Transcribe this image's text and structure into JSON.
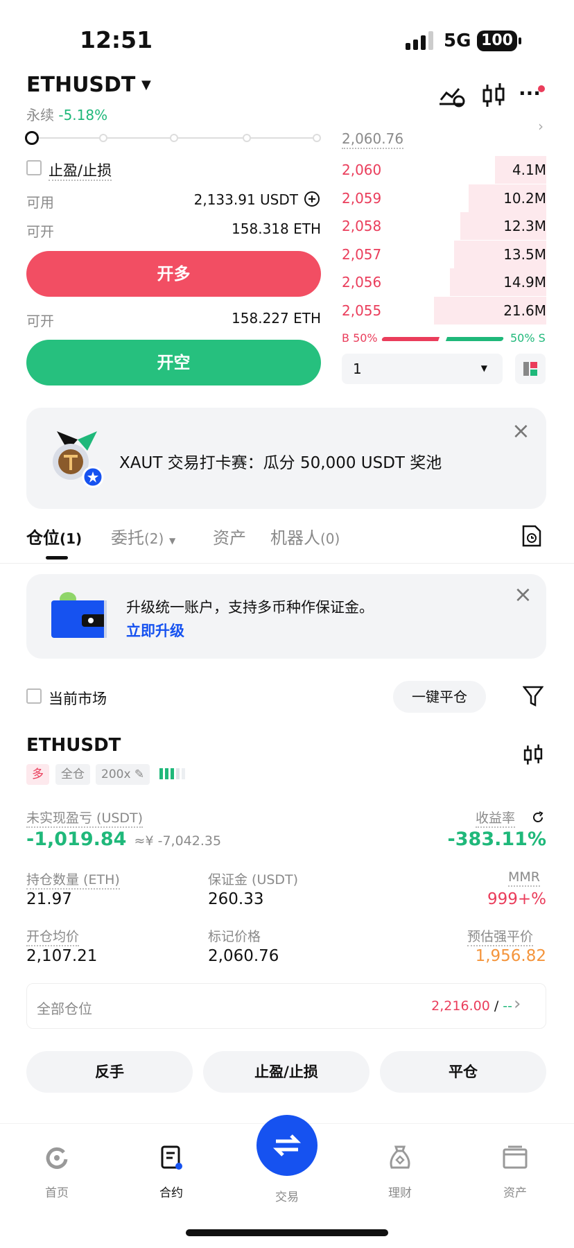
{
  "status": {
    "time": "12:51",
    "network": "5G",
    "battery": "100"
  },
  "header": {
    "symbol": "ETHUSDT",
    "contract_type": "永续",
    "change": "-5.18%"
  },
  "order_form": {
    "tp_sl_label": "止盈/止损",
    "available_label": "可用",
    "available_value": "2,133.91 USDT",
    "long_open_label": "可开",
    "long_open_value": "158.318 ETH",
    "long_button": "开多",
    "short_open_label": "可开",
    "short_open_value": "158.227 ETH",
    "short_button": "开空"
  },
  "order_book": {
    "last_price": "2,060.76",
    "asks": [
      {
        "price": "2,060",
        "qty": "4.1M",
        "depth": 0.25
      },
      {
        "price": "2,059",
        "qty": "10.2M",
        "depth": 0.38
      },
      {
        "price": "2,058",
        "qty": "12.3M",
        "depth": 0.42
      },
      {
        "price": "2,057",
        "qty": "13.5M",
        "depth": 0.45
      },
      {
        "price": "2,056",
        "qty": "14.9M",
        "depth": 0.47
      },
      {
        "price": "2,055",
        "qty": "21.6M",
        "depth": 0.55
      }
    ],
    "buy_ratio": "B 50%",
    "sell_ratio": "50% S",
    "buy_fraction": 0.5,
    "precision_value": "1"
  },
  "promo": {
    "text": "XAUT 交易打卡赛：瓜分 50,000 USDT 奖池"
  },
  "tabs": [
    {
      "label": "仓位",
      "count": "(1)"
    },
    {
      "label": "委托",
      "count": "(2)"
    },
    {
      "label": "资产",
      "count": ""
    },
    {
      "label": "机器人",
      "count": "(0)"
    }
  ],
  "upgrade": {
    "text": "升级统一账户，支持多币种作保证金。",
    "link": "立即升级"
  },
  "filter": {
    "current_market": "当前市场",
    "close_all": "一键平仓"
  },
  "position": {
    "symbol": "ETHUSDT",
    "side": "多",
    "margin_mode": "全仓",
    "leverage": "200x",
    "upnl_label": "未实现盈亏 (USDT)",
    "upnl_value": "-1,019.84",
    "upnl_cny": "≈¥ -7,042.35",
    "roe_label": "收益率",
    "roe_value": "-383.11%",
    "size_label": "持仓数量 (ETH)",
    "size_value": "21.97",
    "margin_label": "保证金 (USDT)",
    "margin_value": "260.33",
    "mmr_label": "MMR",
    "mmr_value": "999+%",
    "entry_label": "开仓均价",
    "entry_value": "2,107.21",
    "mark_label": "标记价格",
    "mark_value": "2,060.76",
    "liq_label": "预估强平价",
    "liq_value": "1,956.82",
    "all_positions_label": "全部仓位",
    "all_positions_value": "2,216.00",
    "all_positions_sep": "/",
    "all_positions_extra": "--"
  },
  "actions": {
    "reverse": "反手",
    "tp_sl": "止盈/止损",
    "close": "平仓"
  },
  "nav": [
    {
      "label": "首页",
      "icon": "home-icon"
    },
    {
      "label": "合约",
      "icon": "contract-icon"
    },
    {
      "label": "交易",
      "icon": "trade-icon"
    },
    {
      "label": "理财",
      "icon": "earn-icon"
    },
    {
      "label": "资产",
      "icon": "assets-icon"
    }
  ],
  "colors": {
    "up": "#1fb87a",
    "down": "#ea3d5b",
    "accent": "#1652f0",
    "warn": "#f4943b"
  }
}
